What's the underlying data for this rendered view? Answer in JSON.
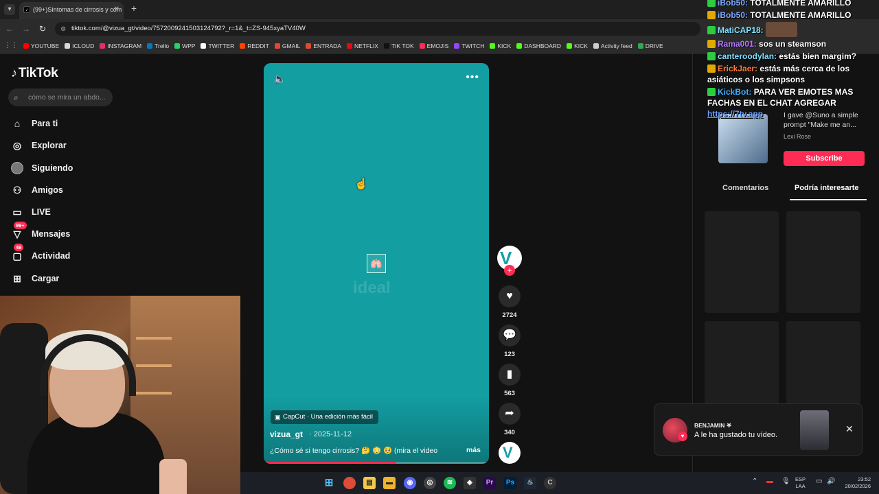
{
  "browser": {
    "tab_title": "(99+)Síntomas de cirrosis y cóm",
    "tab_close": "✕",
    "new_tab": "+",
    "url": "tiktok.com/@vizua_gt/video/7572009241503124792?_r=1&_t=ZS-945xyaTV40W",
    "bookmarks": [
      {
        "label": "YOUTUBE",
        "color": "#ff0000"
      },
      {
        "label": "ICLOUD",
        "color": "#d9d9d9"
      },
      {
        "label": "INSTAGRAM",
        "color": "#e1306c"
      },
      {
        "label": "Trello",
        "color": "#0079bf"
      },
      {
        "label": "WPP",
        "color": "#25d366"
      },
      {
        "label": "TWITTER",
        "color": "#ffffff"
      },
      {
        "label": "REDDIT",
        "color": "#ff4500"
      },
      {
        "label": "GMAIL",
        "color": "#ea4335"
      },
      {
        "label": "ENTRADA",
        "color": "#e04a2f"
      },
      {
        "label": "NETFLIX",
        "color": "#e50914"
      },
      {
        "label": "TIK TOK",
        "color": "#111111"
      },
      {
        "label": "EMOJIS",
        "color": "#ff2d55"
      },
      {
        "label": "TWITCH",
        "color": "#9146ff"
      },
      {
        "label": "KICK",
        "color": "#53fc18"
      },
      {
        "label": "DASHBOARD",
        "color": "#53fc18"
      },
      {
        "label": "KICK",
        "color": "#53fc18"
      },
      {
        "label": "Activity feed",
        "color": "#cccccc"
      },
      {
        "label": "DRIVE",
        "color": "#34a853"
      }
    ]
  },
  "tiktok": {
    "logo": "TikTok",
    "search_placeholder": "cómo se mira un abdo...",
    "nav": [
      {
        "label": "Para ti",
        "icon": "home-icon",
        "glyph": "⌂"
      },
      {
        "label": "Explorar",
        "icon": "compass-icon",
        "glyph": "◎"
      },
      {
        "label": "Siguiendo",
        "icon": "avatar-icon",
        "glyph": "●"
      },
      {
        "label": "Amigos",
        "icon": "friends-icon",
        "glyph": "⚇"
      },
      {
        "label": "LIVE",
        "icon": "live-icon",
        "glyph": "▭"
      },
      {
        "label": "Mensajes",
        "icon": "message-icon",
        "glyph": "▽",
        "badge": "99+"
      },
      {
        "label": "Actividad",
        "icon": "activity-icon",
        "glyph": "▢",
        "badge": "49"
      },
      {
        "label": "Cargar",
        "icon": "upload-icon",
        "glyph": "⊞"
      }
    ],
    "video": {
      "capcut_label": "CapCut · Una edición más fácil",
      "author": "vizua_gt",
      "date": "· 2025-11-12",
      "caption": "¿Cómo sé si tengo cirrosis? 🤔 😳 🥺 (mira el video",
      "more_label": "más",
      "watermark": "ideal",
      "progress": 0.59
    },
    "actions": {
      "likes": "2724",
      "comments": "123",
      "saves": "563",
      "shares": "340"
    },
    "right_panel": {
      "promo_text": "I gave @Suno a simple prompt \"Make me an...",
      "promo_author": "Lexi Rose",
      "subscribe": "Subscribe",
      "tab_comments": "Comentarios",
      "tab_suggest": "Podría interesarte"
    },
    "notification": {
      "name": "BENJAMIN 𖤐",
      "message": "A le ha gustado tu vídeo.",
      "close": "✕"
    }
  },
  "chat": [
    {
      "user": "iBob50:",
      "text": "TOTALMENTE AMARILLO",
      "color": "#7aa7ff"
    },
    {
      "user": "iBob50:",
      "text": "TOTALMENTE AMARILLO",
      "color": "#7aa7ff"
    },
    {
      "user": "MatiCAP18:",
      "text": "",
      "color": "#7fe0ff"
    },
    {
      "user": "Rama001:",
      "text": "sos un steamson",
      "color": "#b07aff"
    },
    {
      "user": "canteroodylan:",
      "text": "estás bien margim?",
      "color": "#7fe0ff"
    },
    {
      "user": "ErickJaer:",
      "text": "estás más cerca de los asiáticos o los simpsons",
      "color": "#ff7a3c"
    },
    {
      "user": "KickBot:",
      "text": "PARA VER EMOTES MAS FACHAS EN EL CHAT AGREGAR",
      "color": "#3fb0ff",
      "link": "https://7tv.app"
    }
  ],
  "taskbar": {
    "lang_top": "ESP",
    "lang_bottom": "LAA",
    "time": "23:52",
    "date": "20/02/2026"
  }
}
